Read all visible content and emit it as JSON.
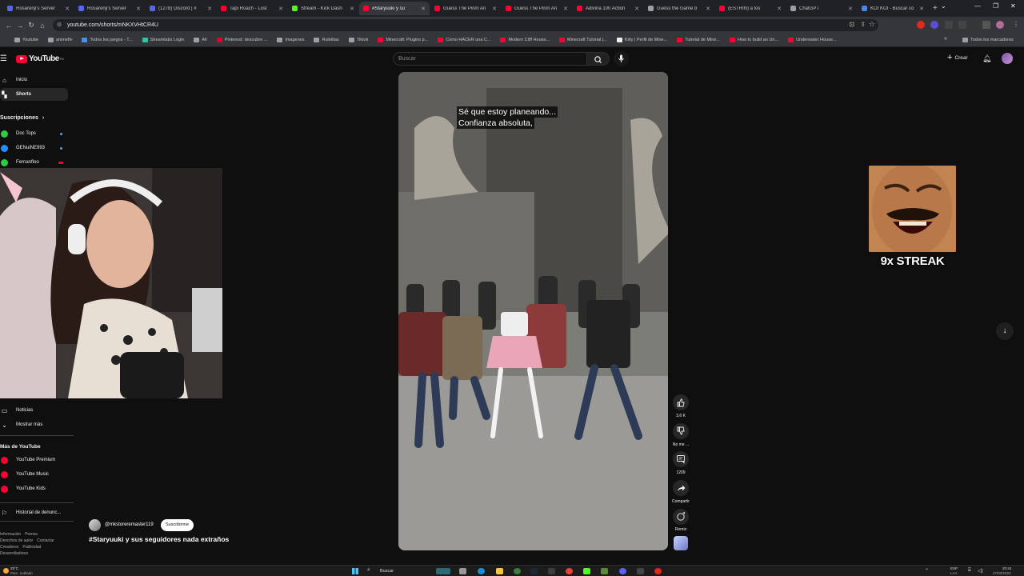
{
  "browser": {
    "tabs": [
      {
        "title": "Rosarenji's Server",
        "color": "#5865f2"
      },
      {
        "title": "Rosarenji's Server",
        "color": "#5865f2"
      },
      {
        "title": "(1278) Discord | #",
        "color": "#5865f2"
      },
      {
        "title": "Tapi Roach - Lost",
        "color": "#ff0033"
      },
      {
        "title": "Stream - Kick Dash",
        "color": "#53fc18"
      },
      {
        "title": "#Staryuuki y su",
        "color": "#ff0033",
        "active": true
      },
      {
        "title": "Guess The Pin/n An",
        "color": "#ff0033"
      },
      {
        "title": "Guess The Pin/n An",
        "color": "#ff0033"
      },
      {
        "title": "Adivina 100 Action",
        "color": "#ff0033"
      },
      {
        "title": "Guess the Game b",
        "color": "#9aa0a6"
      },
      {
        "title": "(ESTRIÑ) a los",
        "color": "#ff0033"
      },
      {
        "title": "ChatGPT",
        "color": "#9aa0a6"
      },
      {
        "title": "KOI KOI - Buscar co",
        "color": "#4285f4"
      }
    ],
    "url": "youtube.com/shorts/mNKXVHtCR4U",
    "bookmarks": [
      {
        "label": "Youtube",
        "color": "#9aa0a6"
      },
      {
        "label": "animeflv",
        "color": "#9aa0a6"
      },
      {
        "label": "Todos los juegos - T...",
        "color": "#4a90e2"
      },
      {
        "label": "Streamlabs Login",
        "color": "#31c3a2"
      },
      {
        "label": "Alí",
        "color": "#9aa0a6"
      },
      {
        "label": "Pinterest: descubre ...",
        "color": "#e60023"
      },
      {
        "label": "Imagenes",
        "color": "#9aa0a6"
      },
      {
        "label": "Ruletitas",
        "color": "#9aa0a6"
      },
      {
        "label": "Tiktok",
        "color": "#9aa0a6"
      },
      {
        "label": "Minecraft: Plugins p...",
        "color": "#ff0033"
      },
      {
        "label": "Como HACER una C...",
        "color": "#ff0033"
      },
      {
        "label": "Modern Cliff House...",
        "color": "#ff0033"
      },
      {
        "label": "Minecraft Tutorial |...",
        "color": "#ff0033"
      },
      {
        "label": "Kitty | Perfil de Mine...",
        "color": "#eeeeee"
      },
      {
        "label": "Tutorial de Mine...",
        "color": "#ff0033"
      },
      {
        "label": "How to build an Un...",
        "color": "#ff0033"
      },
      {
        "label": "Underwater House...",
        "color": "#ff0033"
      }
    ],
    "all_bookmarks_label": "Todos los marcadores"
  },
  "youtube": {
    "logo_text": "YouTube",
    "logo_region": "PE",
    "search_placeholder": "Buscar",
    "create_label": "Crear",
    "sidebar": {
      "home": "Inicio",
      "shorts": "Shorts",
      "subscriptions_header": "Suscripciones",
      "subscriptions": [
        {
          "name": "Doc Tops",
          "color": "#2ecc40"
        },
        {
          "name": "GENuiNE993",
          "color": "#1e90ff"
        },
        {
          "name": "Fernanfloo",
          "color": "#2ecc40",
          "live": true
        }
      ],
      "news": "Noticias",
      "show_more": "Mostrar más",
      "more_header": "Más de YouTube",
      "more_items": [
        "YouTube Premium",
        "YouTube Music",
        "YouTube Kids"
      ],
      "report_history": "Historial de denunc...",
      "footer_links": [
        [
          "Información",
          "Prensa"
        ],
        [
          "Derechos de autor",
          "Contactar"
        ],
        [
          "Creadores",
          "Publicidad"
        ],
        [
          "Desarrolladores"
        ]
      ]
    },
    "short": {
      "caption_lines": [
        "Sé que estoy planeando...",
        "Confianza absoluta,"
      ],
      "channel": "@mkstoreremaster119",
      "subscribe_label": "Suscribirme",
      "title": "#Staryuuki y sus seguidores nada extraños",
      "actions": {
        "likes": "3,6 K",
        "dislike": "No me ...",
        "comments": "1209",
        "share": "Compartir",
        "remix": "Remix"
      }
    },
    "overlay": {
      "streak_text": "9x STREAK"
    }
  },
  "taskbar": {
    "weather_temp": "25°C",
    "weather_desc": "Parc. nublado",
    "search_label": "Buscar",
    "lang": "ESP",
    "lang_sub": "LAA",
    "time": "20:44",
    "date": "27/03/2024"
  }
}
